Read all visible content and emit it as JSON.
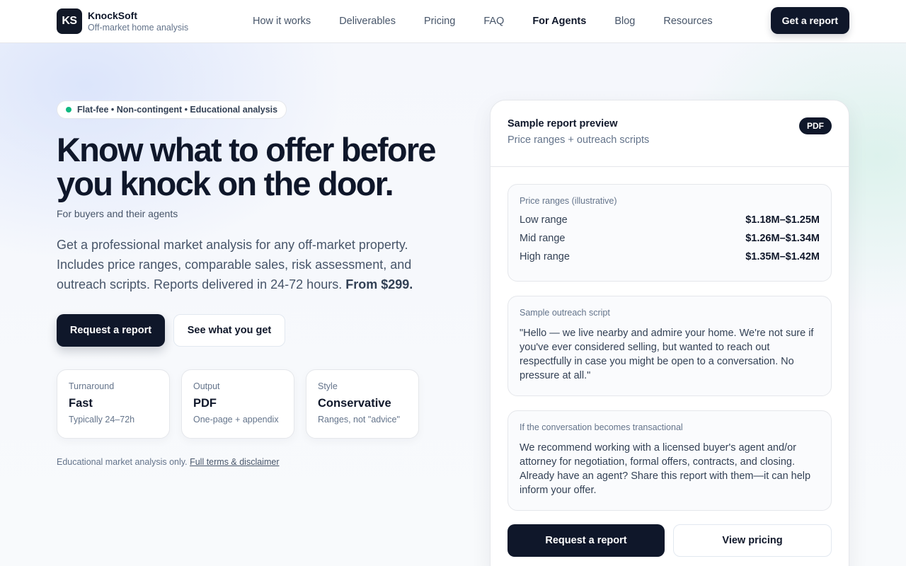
{
  "brand": {
    "logo_text": "KS",
    "name": "KnockSoft",
    "tagline": "Off-market home analysis"
  },
  "nav": {
    "items": [
      {
        "label": "How it works",
        "active": false
      },
      {
        "label": "Deliverables",
        "active": false
      },
      {
        "label": "Pricing",
        "active": false
      },
      {
        "label": "FAQ",
        "active": false
      },
      {
        "label": "For Agents",
        "active": true
      },
      {
        "label": "Blog",
        "active": false
      },
      {
        "label": "Resources",
        "active": false
      }
    ],
    "cta_label": "Get a report"
  },
  "hero": {
    "pill_text": "Flat-fee • Non-contingent • Educational analysis",
    "headline": "Know what to offer before you knock on the door.",
    "subhead": "For buyers and their agents",
    "lead": "Get a professional market analysis for any off-market property. Includes price ranges, comparable sales, risk assessment, and outreach scripts. Reports delivered in 24-72 hours.",
    "lead_bold": "From $299.",
    "primary_button": "Request a report",
    "secondary_button": "See what you get",
    "stats": [
      {
        "key": "Turnaround",
        "value": "Fast",
        "sub": "Typically 24–72h"
      },
      {
        "key": "Output",
        "value": "PDF",
        "sub": "One-page + appendix"
      },
      {
        "key": "Style",
        "value": "Conservative",
        "sub": "Ranges, not \"advice\""
      }
    ],
    "disclaimer_text": "Educational market analysis only.",
    "disclaimer_link": "Full terms & disclaimer"
  },
  "preview": {
    "title": "Sample report preview",
    "subtitle": "Price ranges + outreach scripts",
    "badge": "PDF",
    "prices": {
      "label": "Price ranges (illustrative)",
      "rows": [
        {
          "name": "Low range",
          "value": "$1.18M–$1.25M"
        },
        {
          "name": "Mid range",
          "value": "$1.26M–$1.34M"
        },
        {
          "name": "High range",
          "value": "$1.35M–$1.42M"
        }
      ]
    },
    "script": {
      "label": "Sample outreach script",
      "text": "\"Hello — we live nearby and admire your home. We're not sure if you've ever considered selling, but wanted to reach out respectfully in case you might be open to a conversation. No pressure at all.\""
    },
    "transactional": {
      "label": "If the conversation becomes transactional",
      "text": "We recommend working with a licensed buyer's agent and/or attorney for negotiation, formal offers, contracts, and closing. Already have an agent? Share this report with them—it can help inform your offer."
    },
    "primary_button": "Request a report",
    "secondary_button": "View pricing"
  },
  "colors": {
    "ink": "#0f172a",
    "muted": "#64748b",
    "accent_dot": "#10b981"
  }
}
